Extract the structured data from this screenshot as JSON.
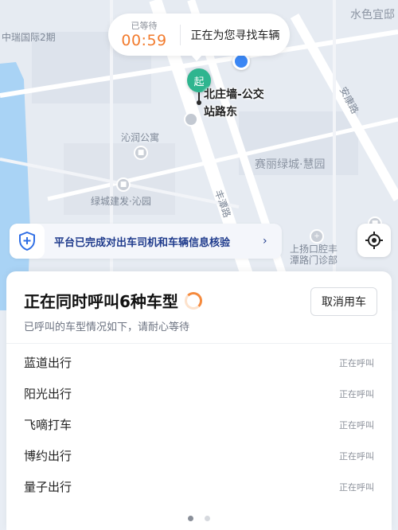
{
  "map": {
    "labels": {
      "top_left": "中瑞国际2期",
      "top_right": "水色宜邸",
      "qinrun": "沁润公寓",
      "sailv": "赛丽绿城·慧园",
      "lvcheng": "绿城建发·沁园",
      "fengtan_rd": "丰潭路",
      "ankang_rd": "安康路",
      "clinic": "上扬口腔丰潭路门诊部"
    },
    "start_marker": "起",
    "start_label_line1": "北庄墙-公交",
    "start_label_line2": "站路东"
  },
  "wait_bubble": {
    "label": "已等待",
    "time": "00:59",
    "status": "正在为您寻找车辆"
  },
  "verify_banner": {
    "text": "平台已完成对出车司机和车辆信息核验",
    "chevron": "›"
  },
  "sheet": {
    "title": "正在同时呼叫6种车型",
    "subtitle": "已呼叫的车型情况如下，请耐心等待",
    "cancel_label": "取消用车",
    "cars": [
      {
        "name": "蓝道出行",
        "status": "正在呼叫"
      },
      {
        "name": "阳光出行",
        "status": "正在呼叫"
      },
      {
        "name": "飞嘀打车",
        "status": "正在呼叫"
      },
      {
        "name": "博约出行",
        "status": "正在呼叫"
      },
      {
        "name": "量子出行",
        "status": "正在呼叫"
      }
    ],
    "pager": {
      "pages": 2,
      "current": 1
    }
  },
  "colors": {
    "accent_orange": "#f27b2d",
    "start_green": "#2fb58f",
    "banner_blue": "#1f3b8c",
    "location_blue": "#3b87f5"
  }
}
